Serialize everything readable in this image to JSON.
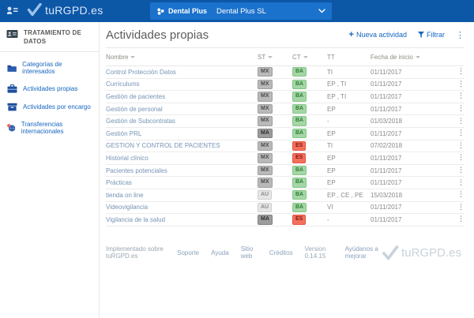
{
  "header": {
    "logo_text": "tuRGPD.es",
    "org_label": "Dental Plus",
    "org_select_value": "Dental Plus SL"
  },
  "sidebar": {
    "section_title": "TRATAMIENTO DE DATOS",
    "items": [
      {
        "icon": "folder-icon",
        "label": "Categorías de interesados"
      },
      {
        "icon": "briefcase-icon",
        "label": "Actividades propias"
      },
      {
        "icon": "archive-icon",
        "label": "Actividades por encargo"
      },
      {
        "icon": "globe-badge-icon",
        "label": "Transferencias internacionales"
      }
    ]
  },
  "main": {
    "title": "Actividades propias",
    "toolbar": {
      "new_activity": "Nueva actividad",
      "filter": "Filtrar"
    },
    "table": {
      "columns": [
        "Nombre",
        "ST",
        "CT",
        "TT",
        "Fecha de inicio"
      ],
      "rows": [
        {
          "name": "Control Protección Datos",
          "st": "MX",
          "ct": "BA",
          "tt": "TI",
          "date": "01/11/2017"
        },
        {
          "name": "Curriculums",
          "st": "MX",
          "ct": "BA",
          "tt": "EP , TI",
          "date": "01/11/2017"
        },
        {
          "name": "Gestión de pacientes",
          "st": "MX",
          "ct": "BA",
          "tt": "EP , TI",
          "date": "01/11/2017"
        },
        {
          "name": "Gestión de personal",
          "st": "MX",
          "ct": "BA",
          "tt": "EP",
          "date": "01/11/2017"
        },
        {
          "name": "Gestión de Subcontratas",
          "st": "MX",
          "ct": "BA",
          "tt": "-",
          "date": "01/03/2018"
        },
        {
          "name": "Gestión PRL",
          "st": "MA",
          "ct": "BA",
          "tt": "EP",
          "date": "01/11/2017"
        },
        {
          "name": "GESTION Y CONTROL DE PACIENTES",
          "st": "MX",
          "ct": "ES",
          "tt": "TI",
          "date": "07/02/2018"
        },
        {
          "name": "Historial clínico",
          "st": "MX",
          "ct": "ES",
          "tt": "EP",
          "date": "01/11/2017"
        },
        {
          "name": "Pacientes potenciales",
          "st": "MX",
          "ct": "BA",
          "tt": "EP",
          "date": "01/11/2017"
        },
        {
          "name": "Prácticas",
          "st": "MX",
          "ct": "BA",
          "tt": "EP",
          "date": "01/11/2017"
        },
        {
          "name": "tienda on line",
          "st": "AU",
          "ct": "BA",
          "tt": "EP , CE , PE",
          "date": "15/03/2018"
        },
        {
          "name": "Videovigilancia",
          "st": "AU",
          "ct": "BA",
          "tt": "VI",
          "date": "01/11/2017"
        },
        {
          "name": "Vigilancia de la salud",
          "st": "MA",
          "ct": "ES",
          "tt": "-",
          "date": "01/11/2017"
        }
      ]
    }
  },
  "footer": {
    "implemented": "Implementado sobre tuRGPD.es",
    "links": [
      "Soporte",
      "Ayuda",
      "Sitio web",
      "Créditos"
    ],
    "version": "Version 0.14.15",
    "improve": "Ayúdanos a mejorar",
    "logo_text": "tuRGPD.es"
  },
  "colors": {
    "header_bg": "#0d57a7",
    "org_bar_bg": "#1b72cc",
    "accent_blue": "#1565c0",
    "badges": {
      "MX": {
        "bg": "#b9b9b9",
        "border": "#9e9e9e",
        "text": "#4c4c4c"
      },
      "MA": {
        "bg": "#9c9c9c",
        "border": "#808080",
        "text": "#2f2f2f"
      },
      "AU": {
        "bg": "#e6e6e6",
        "border": "#cfcfcf",
        "text": "#8c8c8c"
      },
      "BA": {
        "bg": "#a5d6a7",
        "border": "#81c784",
        "text": "#2e7d32"
      },
      "ES": {
        "bg": "#f4705c",
        "border": "#e35542",
        "text": "#7f1511"
      }
    }
  }
}
